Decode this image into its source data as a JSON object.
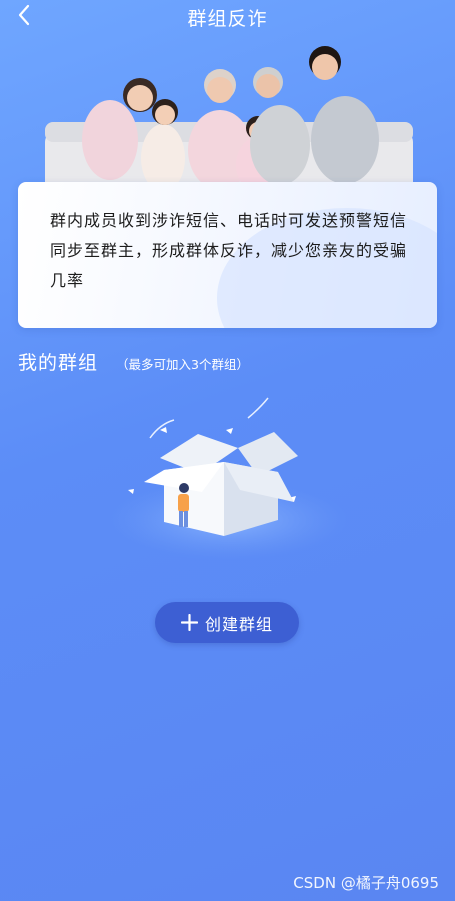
{
  "header": {
    "title": "群组反诈"
  },
  "info": {
    "text": "群内成员收到涉诈短信、电话时可发送预警短信同步至群主，形成群体反诈，减少您亲友的受骗几率"
  },
  "section": {
    "title": "我的群组",
    "subtitle": "（最多可加入3个群组）"
  },
  "actions": {
    "create_label": "创建群组"
  },
  "watermark": {
    "text": "CSDN @橘子舟0695"
  },
  "colors": {
    "accent": "#3d5fd3",
    "background": "#5c8df7"
  }
}
